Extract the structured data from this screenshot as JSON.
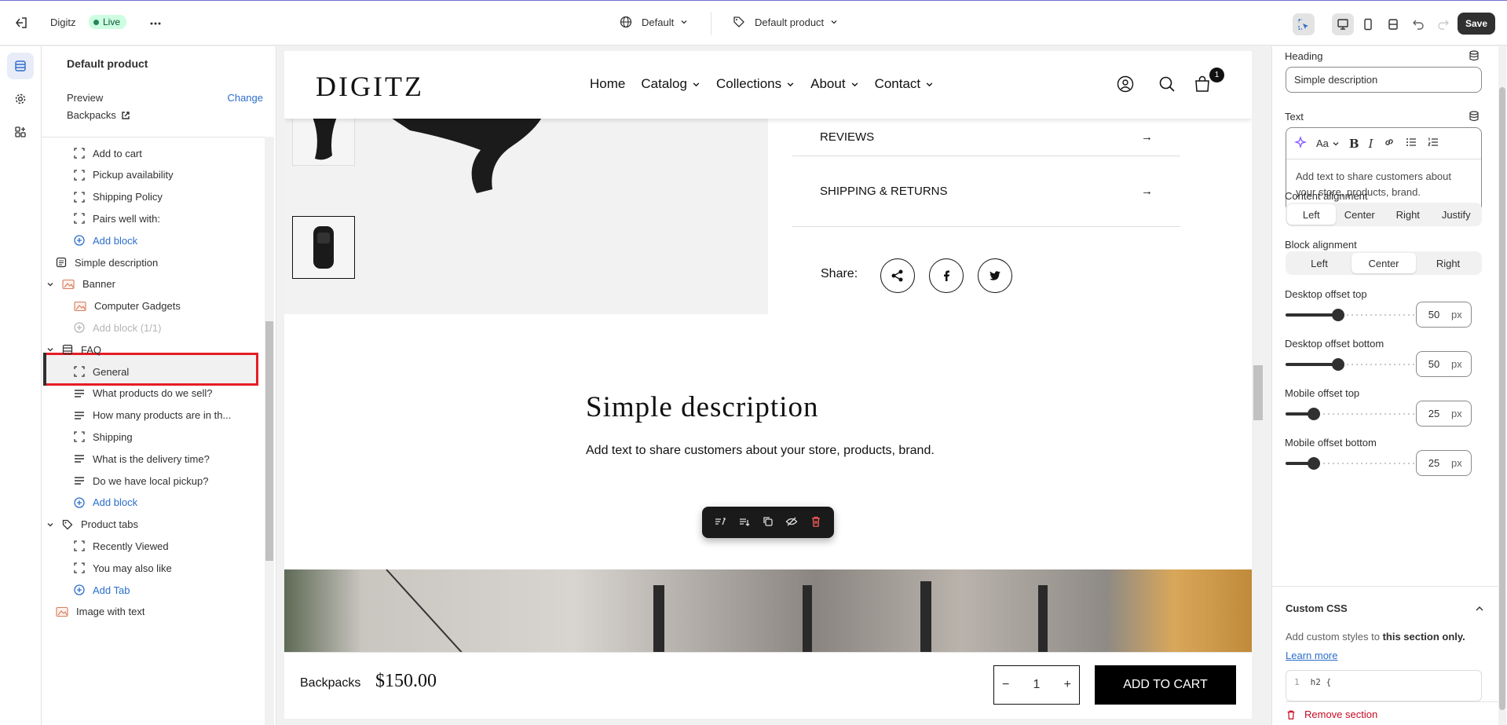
{
  "topbar": {
    "store_name": "Digitz",
    "live_label": "Live",
    "theme_select": "Default",
    "template_select": "Default product",
    "save_label": "Save"
  },
  "left_panel": {
    "title": "Default product",
    "preview_label": "Preview",
    "change_label": "Change",
    "preview_value": "Backpacks",
    "tree": [
      {
        "label": "Add to cart",
        "icon": "block-icon",
        "indent": 2,
        "style": "normal"
      },
      {
        "label": "Pickup availability",
        "icon": "block-icon",
        "indent": 2,
        "style": "normal"
      },
      {
        "label": "Shipping Policy",
        "icon": "block-icon",
        "indent": 2,
        "style": "normal"
      },
      {
        "label": "Pairs well with:",
        "icon": "block-icon",
        "indent": 2,
        "style": "normal"
      },
      {
        "label": "Add block",
        "icon": "plus-circle-icon",
        "indent": 2,
        "style": "blue"
      },
      {
        "label": "Simple description",
        "icon": "text-section-icon",
        "indent": 1,
        "style": "selected"
      },
      {
        "label": "Banner",
        "icon": "image-section-icon",
        "indent": 1,
        "style": "section"
      },
      {
        "label": "Computer Gadgets",
        "icon": "image-section-icon",
        "indent": 2,
        "style": "normal"
      },
      {
        "label": "Add block (1/1)",
        "icon": "plus-circle-icon",
        "indent": 2,
        "style": "disabled"
      },
      {
        "label": "FAQ",
        "icon": "list-section-icon",
        "indent": 1,
        "style": "section"
      },
      {
        "label": "General",
        "icon": "block-icon",
        "indent": 2,
        "style": "normal"
      },
      {
        "label": "What products do we sell?",
        "icon": "text-lines-icon",
        "indent": 2,
        "style": "normal"
      },
      {
        "label": "How many products are in th...",
        "icon": "text-lines-icon",
        "indent": 2,
        "style": "normal"
      },
      {
        "label": "Shipping",
        "icon": "block-icon",
        "indent": 2,
        "style": "normal"
      },
      {
        "label": "What is the delivery time?",
        "icon": "text-lines-icon",
        "indent": 2,
        "style": "normal"
      },
      {
        "label": "Do we have local pickup?",
        "icon": "text-lines-icon",
        "indent": 2,
        "style": "normal"
      },
      {
        "label": "Add block",
        "icon": "plus-circle-icon",
        "indent": 2,
        "style": "blue"
      },
      {
        "label": "Product tabs",
        "icon": "tag-icon",
        "indent": 1,
        "style": "section"
      },
      {
        "label": "Recently Viewed",
        "icon": "block-icon",
        "indent": 2,
        "style": "normal"
      },
      {
        "label": "You may also like",
        "icon": "block-icon",
        "indent": 2,
        "style": "normal"
      },
      {
        "label": "Add Tab",
        "icon": "plus-circle-icon",
        "indent": 2,
        "style": "blue"
      },
      {
        "label": "Image with text",
        "icon": "image-section-icon",
        "indent": 1,
        "style": "normal"
      }
    ]
  },
  "preview": {
    "logo": "DIGITZ",
    "nav": [
      "Home",
      "Catalog",
      "Collections",
      "About",
      "Contact"
    ],
    "nav_dropdowns": [
      false,
      true,
      true,
      true,
      true
    ],
    "cart_count": "1",
    "accordion": [
      "REVIEWS",
      "SHIPPING & RETURNS"
    ],
    "share_label": "Share:",
    "section_title": "Simple description",
    "section_text": "Add text to share customers about your store, products, brand.",
    "sticky_name": "Backpacks",
    "sticky_price": "$150.00",
    "qty": "1",
    "add_to_cart": "ADD TO CART"
  },
  "right_panel": {
    "heading_label": "Heading",
    "heading_value": "Simple description",
    "text_label": "Text",
    "text_value": "Add text to share customers about your store, products, brand.",
    "rte_font_label": "Aa",
    "content_alignment_label": "Content alignment",
    "content_alignment_options": [
      "Left",
      "Center",
      "Right",
      "Justify"
    ],
    "content_alignment_selected": "Left",
    "block_alignment_label": "Block alignment",
    "block_alignment_options": [
      "Left",
      "Center",
      "Right"
    ],
    "block_alignment_selected": "Center",
    "sliders": [
      {
        "label": "Desktop offset top",
        "value": "50",
        "unit": "px",
        "fraction": 0.41
      },
      {
        "label": "Desktop offset bottom",
        "value": "50",
        "unit": "px",
        "fraction": 0.41
      },
      {
        "label": "Mobile offset top",
        "value": "25",
        "unit": "px",
        "fraction": 0.22
      },
      {
        "label": "Mobile offset bottom",
        "value": "25",
        "unit": "px",
        "fraction": 0.22
      }
    ],
    "custom_css_title": "Custom CSS",
    "custom_css_desc_prefix": "Add custom styles to ",
    "custom_css_desc_bold": "this section only.",
    "learn_more": "Learn more",
    "code_line_no": "1",
    "code_line": "h2 {",
    "remove_section": "Remove section"
  }
}
